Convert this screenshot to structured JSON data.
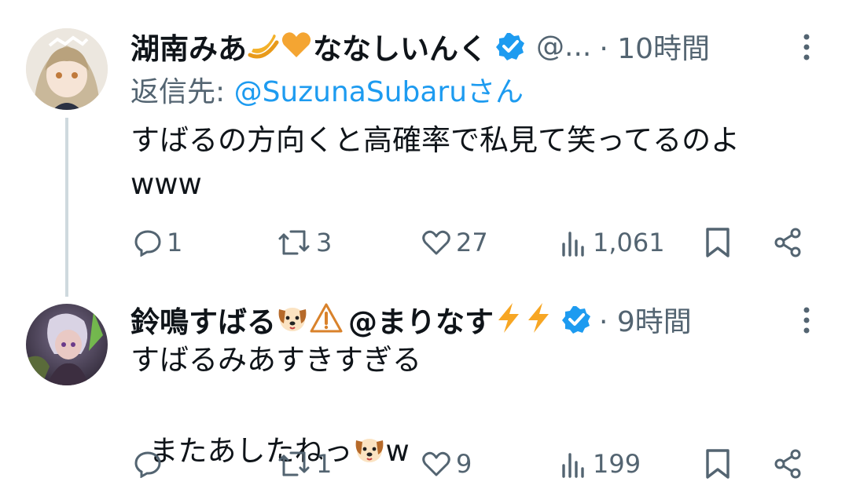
{
  "tweets": [
    {
      "name": "湖南みあ",
      "name_suffix": "ななしいんく",
      "handle": "@...",
      "time": "· 10時間",
      "reply_label": "返信先: ",
      "reply_handle": "@SuzunaSubaru",
      "reply_suffix": "さん",
      "text_line1": "すばるの方向くと高確率で私見て笑ってるのよ",
      "text_line2": "www",
      "replies": "1",
      "retweets": "3",
      "likes": "27",
      "views": "1,061"
    },
    {
      "name": "鈴鳴すばる",
      "name_suffix": "@まりなす",
      "time": "· 9時間",
      "text_line1": "すばるみあすきすぎる",
      "text_line2": "またあしたねっ",
      "text_line2_tail": "w",
      "replies": "",
      "retweets": "1",
      "likes": "9",
      "views": "199"
    }
  ],
  "colors": {
    "accent": "#1d9bf0",
    "secondary": "#536471",
    "verified": "#1d9bf0"
  }
}
